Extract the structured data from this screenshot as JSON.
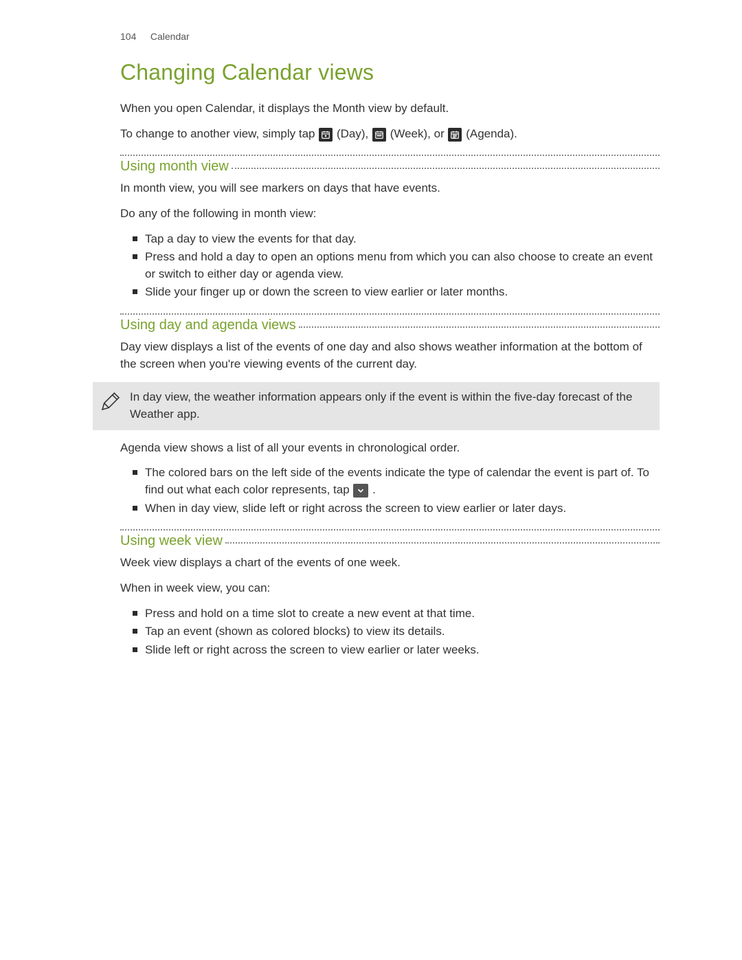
{
  "header": {
    "page_number": "104",
    "section": "Calendar"
  },
  "title": "Changing Calendar views",
  "intro1": "When you open Calendar, it displays the Month view by default.",
  "intro2a": "To change to another view, simply tap ",
  "intro2b": " (Day), ",
  "intro2c": " (Week), or ",
  "intro2d": " (Agenda).",
  "icons": {
    "day": "calendar-day",
    "week": "calendar-week",
    "agenda": "calendar-agenda",
    "chevron": "chevron-down"
  },
  "sections": {
    "month": {
      "heading": "Using month view",
      "p1": "In month view, you will see markers on days that have events.",
      "p2": "Do any of the following in month view:",
      "bullets": [
        "Tap a day to view the events for that day.",
        "Press and hold a day to open an options menu from which you can also choose to create an event or switch to either day or agenda view.",
        "Slide your finger up or down the screen to view earlier or later months."
      ]
    },
    "dayagenda": {
      "heading": "Using day and agenda views",
      "p1": "Day view displays a list of the events of one day and also shows weather information at the bottom of the screen when you're viewing events of the current day.",
      "note": "In day view, the weather information appears only if the event is within the five-day forecast of the Weather app.",
      "p2": "Agenda view shows a list of all your events in chronological order.",
      "bullet1a": "The colored bars on the left side of the events indicate the type of calendar the event is part of. To find out what each color represents, tap ",
      "bullet1b": ".",
      "bullet2": "When in day view, slide left or right across the screen to view earlier or later days."
    },
    "week": {
      "heading": "Using week view",
      "p1": "Week view displays a chart of the events of one week.",
      "p2": "When in week view, you can:",
      "bullets": [
        "Press and hold on a time slot to create a new event at that time.",
        "Tap an event (shown as colored blocks) to view its details.",
        "Slide left or right across the screen to view earlier or later weeks."
      ]
    }
  }
}
